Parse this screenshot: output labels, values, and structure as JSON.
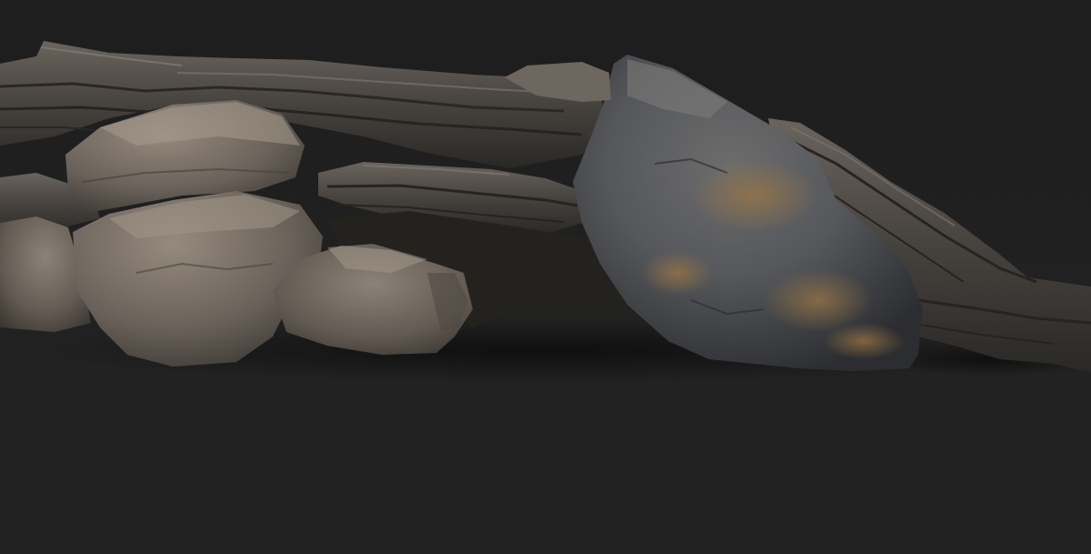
{
  "scene": {
    "subject": "rock-formation",
    "colors": {
      "background": "#1f1f1f",
      "floor": "#262626",
      "rock_light": "#8a8074",
      "rock_mid": "#5c5650",
      "rock_dark": "#2f2d2b",
      "rock_blue_gray": "#4a4e55",
      "ochre_stain": "#8a6a3f",
      "shadow": "#121212"
    }
  }
}
